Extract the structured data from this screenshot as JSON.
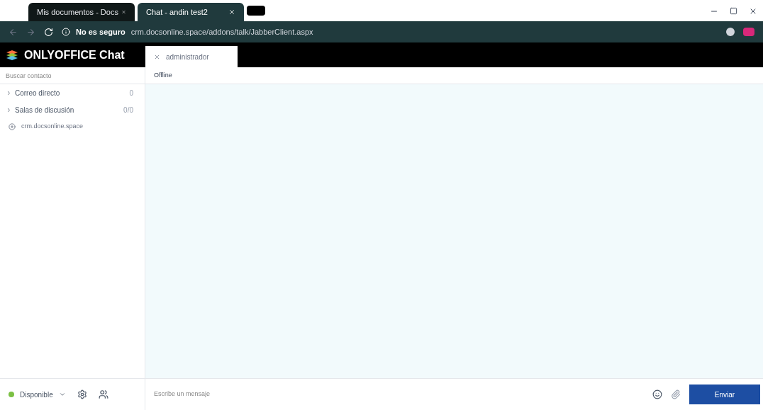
{
  "browser": {
    "tabs": [
      {
        "title": "Mis documentos - Docs",
        "selected": false
      },
      {
        "title": "Chat - andin test2",
        "selected": true
      }
    ],
    "security": "No es seguro",
    "url": "crm.docsonline.space/addons/talk/JabberClient.aspx"
  },
  "app": {
    "logo": "ONLYOFFICE Chat"
  },
  "chat_tabs": [
    {
      "label": "administrador",
      "selected": true
    }
  ],
  "chat_status": "Offline",
  "sidebar": {
    "search": {
      "placeholder": "Buscar contacto"
    },
    "groups": [
      {
        "label": "Correo directo",
        "count": "0",
        "expanded": false
      },
      {
        "label": "Salas de discusión",
        "count": "0/0",
        "expanded": false
      }
    ],
    "action": "crm.docsonline.space"
  },
  "footer": {
    "status": {
      "label": "Disponible",
      "color": "#7bc043"
    },
    "message": {
      "placeholder": "Escribe un mensaje"
    },
    "send": "Enviar"
  }
}
